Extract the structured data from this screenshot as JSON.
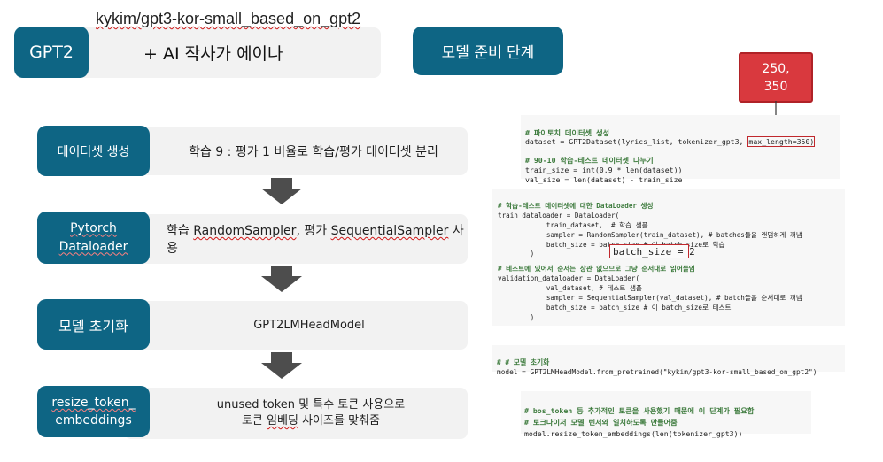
{
  "header": {
    "model_name": "kykim/gpt3-kor-small_based_on_gpt2",
    "gpt2_badge": "GPT2",
    "ai_writer": "+ AI 작사가 에이나",
    "stage_title": "모델 준비 단계"
  },
  "annotation": {
    "max_length_values": "250,\n350"
  },
  "steps": [
    {
      "label": "데이터셋 생성",
      "description": "학습 9 : 평가 1 비율로 학습/평가 데이터셋 분리"
    },
    {
      "label": "Pytorch Dataloader",
      "label_line1": "Pytorch",
      "label_line2": "Dataloader",
      "description_pre": "학습 ",
      "description_sampler1": "RandomSampler",
      "description_mid": ", 평가 ",
      "description_sampler2": "SequentialSampler",
      "description_post": " 사용"
    },
    {
      "label": "모델 초기화",
      "description": "GPT2LMHeadModel"
    },
    {
      "label": "resize_token_ embeddings",
      "label_line1": "resize_token_",
      "label_line2": "embeddings",
      "description_line1": "unused token 및 특수 토큰 사용으로",
      "description_line2_pre": "토큰 ",
      "description_line2_squig": "임베딩",
      "description_line2_post": " 사이즈를 맞춰줌"
    }
  ],
  "code_blocks": {
    "dataset": {
      "c1": "# 파이토치 데이터셋 생성",
      "l1_pre": "dataset = GPT2Dataset(lyrics_list, tokenizer_gpt3, ",
      "l1_box": "max_length=350)",
      "c2": "# 90-10 학습-테스트 데이터셋 나누기",
      "l2": "train_size = int(0.9 * len(dataset))",
      "l3": "val_size = len(dataset) - train_size"
    },
    "dataloader": {
      "c1": "# 학습-테스트 데이터셋에 대한 DataLoader 생성",
      "l1": "train_dataloader = DataLoader(",
      "l2": "            train_dataset,  # 학습 샘플",
      "l3": "            sampler = RandomSampler(train_dataset), # batches들을 랜덤하게 꺼냄",
      "l4": "            batch_size = batch_size # 이 batch_size로 학습",
      "l5": "        )",
      "batch_box": "batch_size = 2",
      "c2": "# 테스트에 있어서 순서는 상관 없으므로 그냥 순서대로 읽어들임",
      "l6": "validation_dataloader = DataLoader(",
      "l7": "            val_dataset, # 테스트 샘플",
      "l8": "            sampler = SequentialSampler(val_dataset), # batch들을 순서대로 꺼냄",
      "l9": "            batch_size = batch_size # 이 batch_size로 테스트",
      "l10": "        )"
    },
    "model": {
      "c1": "# # 모델 초기화",
      "l1": "model = GPT2LMHeadModel.from_pretrained(\"kykim/gpt3-kor-small_based_on_gpt2\")"
    },
    "resize": {
      "c1": "# bos_token 등 추가적인 토큰을 사용했기 때문에 이 단계가 필요함",
      "c2": "# 토크나이저 모델 텐서와 일치하도록 만들어줌",
      "l1": "model.resize_token_embeddings(len(tokenizer_gpt3))"
    }
  },
  "colors": {
    "teal": "#0e6584",
    "red": "#d9393e",
    "gray_box": "#f2f2f2",
    "arrow": "#4d4d4d"
  }
}
